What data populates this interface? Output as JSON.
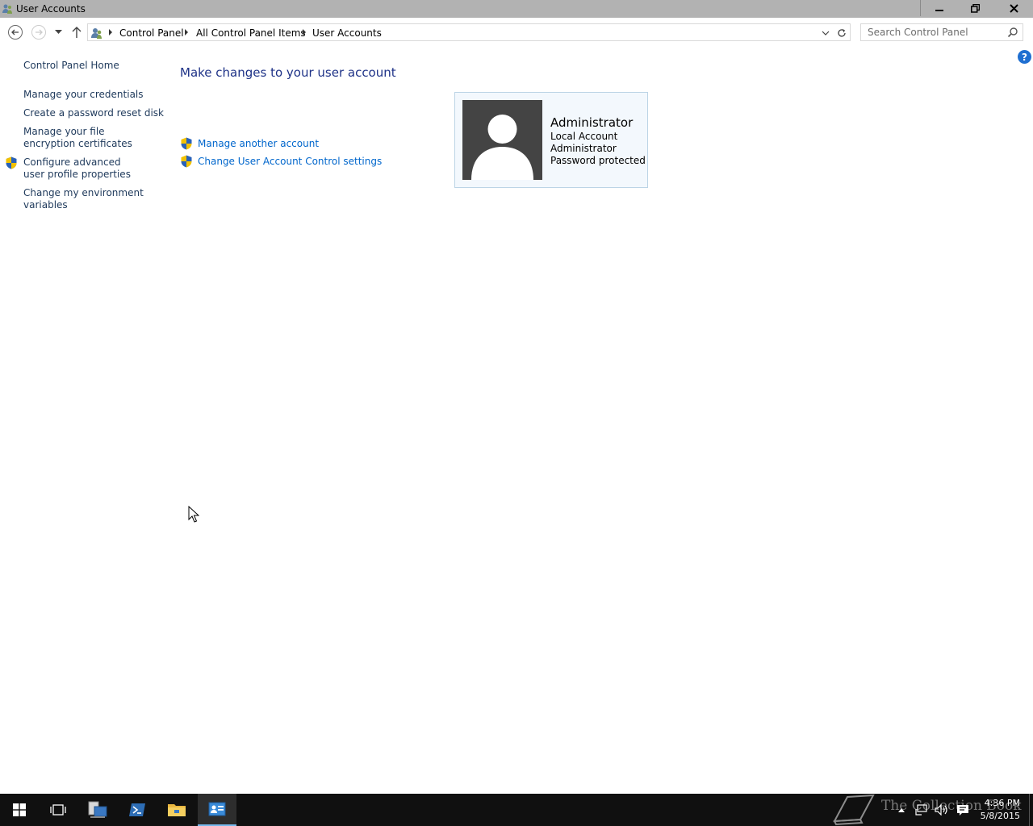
{
  "window": {
    "title": "User Accounts"
  },
  "address_bar": {
    "crumbs": [
      "Control Panel",
      "All Control Panel Items",
      "User Accounts"
    ]
  },
  "search": {
    "placeholder": "Search Control Panel"
  },
  "help": {
    "glyph": "?"
  },
  "sidebar": {
    "home": "Control Panel Home",
    "links": [
      "Manage your credentials",
      "Create a password reset disk",
      "Manage your file encryption certificates",
      "Configure advanced user profile properties",
      "Change my environment variables"
    ]
  },
  "main": {
    "title": "Make changes to your user account",
    "tasks": [
      "Manage another account",
      "Change User Account Control settings"
    ]
  },
  "account": {
    "name": "Administrator",
    "details": [
      "Local Account",
      "Administrator",
      "Password protected"
    ]
  },
  "taskbar": {
    "clock_time": "4:36 PM",
    "clock_date": "5/8/2015",
    "watermark": "The Collection Book"
  },
  "colors": {
    "link": "#1e395b",
    "task_link": "#0066cc",
    "title": "#1e3287",
    "titlebar": "#b2b2b2",
    "taskbar": "#101010"
  }
}
